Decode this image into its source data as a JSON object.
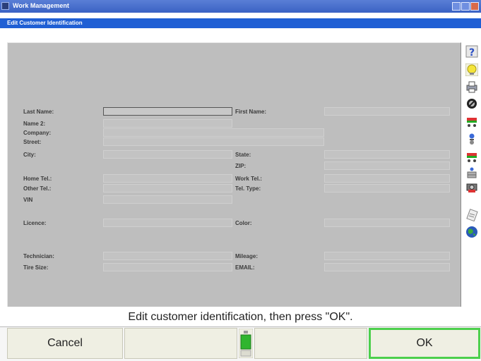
{
  "window": {
    "title": "Work Management"
  },
  "screen": {
    "title": "Edit Customer Identification"
  },
  "form": {
    "last_name_label": "Last Name:",
    "first_name_label": "First Name:",
    "name2_label": "Name 2:",
    "company_label": "Company:",
    "street_label": "Street:",
    "city_label": "City:",
    "state_label": "State:",
    "zip_label": "ZIP:",
    "home_tel_label": "Home Tel.:",
    "work_tel_label": "Work Tel.:",
    "other_tel_label": "Other Tel.:",
    "tel_type_label": "Tel. Type:",
    "vin_label": "VIN",
    "licence_label": "Licence:",
    "color_label": "Color:",
    "technician_label": "Technician:",
    "mileage_label": "Mileage:",
    "tire_size_label": "Tire Size:",
    "email_label": "EMAIL:"
  },
  "toolbar": {
    "icons": [
      "help-icon",
      "lightbulb-icon",
      "print-icon",
      "stop-icon",
      "vehicle-specs-icon",
      "sensor-icon",
      "vehicle-specs-2-icon",
      "measure-icon",
      "camera-icon",
      "report-icon",
      "globe-icon"
    ]
  },
  "status": {
    "prompt": "Edit customer identification, then press \"OK\"."
  },
  "buttons": {
    "cancel": "Cancel",
    "ok": "OK"
  }
}
